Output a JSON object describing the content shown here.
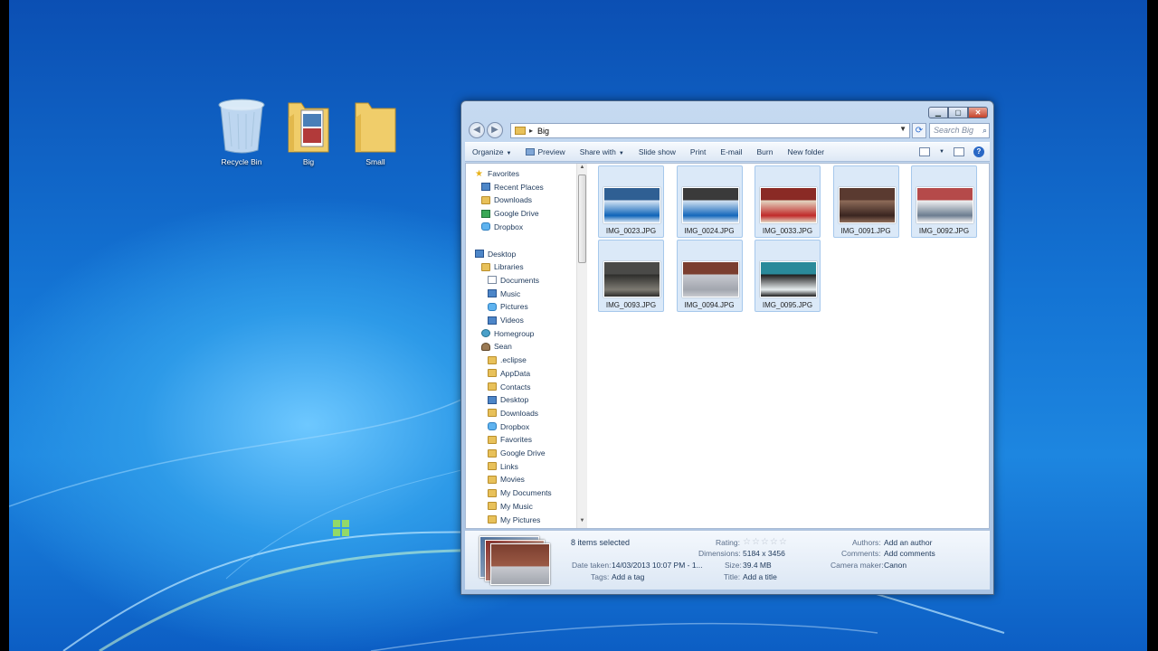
{
  "desktop": {
    "icons": [
      {
        "label": "Recycle Bin",
        "icon": "recycle-bin-icon"
      },
      {
        "label": "Big",
        "icon": "folder-icon"
      },
      {
        "label": "Small",
        "icon": "folder-icon"
      }
    ]
  },
  "window": {
    "caption_buttons": {
      "minimize": "▁",
      "maximize": "▢",
      "close": "✕"
    },
    "address": {
      "path_segment": "Big",
      "separator": "▸"
    },
    "search": {
      "placeholder": "Search Big"
    },
    "nav_buttons": {
      "back": "◀",
      "forward": "▶",
      "refresh": "⟳"
    },
    "toolbar": {
      "organize": "Organize",
      "preview": "Preview",
      "share_with": "Share with",
      "slide_show": "Slide show",
      "print": "Print",
      "email": "E-mail",
      "burn": "Burn",
      "new_folder": "New folder",
      "help": "?"
    },
    "nav_pane": [
      {
        "label": "Favorites",
        "icon": "star"
      },
      {
        "label": "Recent Places",
        "icon": "blue"
      },
      {
        "label": "Downloads",
        "icon": "folder"
      },
      {
        "label": "Google Drive",
        "icon": "green"
      },
      {
        "label": "Dropbox",
        "icon": "sky"
      },
      {
        "label": "Desktop",
        "icon": "blue"
      },
      {
        "label": "Libraries",
        "icon": "folder"
      },
      {
        "label": "Documents",
        "icon": "doc"
      },
      {
        "label": "Music",
        "icon": "blue"
      },
      {
        "label": "Pictures",
        "icon": "sky"
      },
      {
        "label": "Videos",
        "icon": "blue"
      },
      {
        "label": "Homegroup",
        "icon": "teal"
      },
      {
        "label": "Sean",
        "icon": "person"
      },
      {
        "label": ".eclipse",
        "icon": "folder"
      },
      {
        "label": "AppData",
        "icon": "folder"
      },
      {
        "label": "Contacts",
        "icon": "folder"
      },
      {
        "label": "Desktop",
        "icon": "blue"
      },
      {
        "label": "Downloads",
        "icon": "folder"
      },
      {
        "label": "Dropbox",
        "icon": "sky"
      },
      {
        "label": "Favorites",
        "icon": "folder"
      },
      {
        "label": "Google Drive",
        "icon": "folder"
      },
      {
        "label": "Links",
        "icon": "folder"
      },
      {
        "label": "Movies",
        "icon": "folder"
      },
      {
        "label": "My Documents",
        "icon": "folder"
      },
      {
        "label": "My Music",
        "icon": "folder"
      },
      {
        "label": "My Pictures",
        "icon": "folder"
      }
    ],
    "files": [
      {
        "name": "IMG_0023.JPG",
        "colors": [
          "#2f5f93",
          "#d9e7f5",
          "#0e63b8"
        ]
      },
      {
        "name": "IMG_0024.JPG",
        "colors": [
          "#3a3a3a",
          "#d6e4f2",
          "#1467bb"
        ]
      },
      {
        "name": "IMG_0033.JPG",
        "colors": [
          "#8a2a25",
          "#e4d9c4",
          "#c02a2a"
        ]
      },
      {
        "name": "IMG_0091.JPG",
        "colors": [
          "#5a3a30",
          "#8f6d5a",
          "#3a2520"
        ]
      },
      {
        "name": "IMG_0092.JPG",
        "colors": [
          "#b54a4a",
          "#f2f2f2",
          "#6b7c90"
        ]
      },
      {
        "name": "IMG_0093.JPG",
        "colors": [
          "#4a4a48",
          "#2d2d2b",
          "#7d7a72"
        ]
      },
      {
        "name": "IMG_0094.JPG",
        "colors": [
          "#7b3e2f",
          "#c7c9cf",
          "#a2a6ae"
        ]
      },
      {
        "name": "IMG_0095.JPG",
        "colors": [
          "#2a8a9a",
          "#1b1b1b",
          "#e8eef0"
        ]
      }
    ],
    "details": {
      "selection": "8 items selected",
      "date_taken_label": "Date taken:",
      "date_taken_value": "14/03/2013 10:07 PM - 1...",
      "tags_label": "Tags:",
      "tags_value": "Add a tag",
      "rating_label": "Rating:",
      "rating_value": "☆☆☆☆☆",
      "dimensions_label": "Dimensions:",
      "dimensions_value": "5184 x 3456",
      "size_label": "Size:",
      "size_value": "39.4 MB",
      "title_label": "Title:",
      "title_value": "Add a title",
      "authors_label": "Authors:",
      "authors_value": "Add an author",
      "comments_label": "Comments:",
      "comments_value": "Add comments",
      "camera_label": "Camera maker:",
      "camera_value": "Canon"
    }
  }
}
